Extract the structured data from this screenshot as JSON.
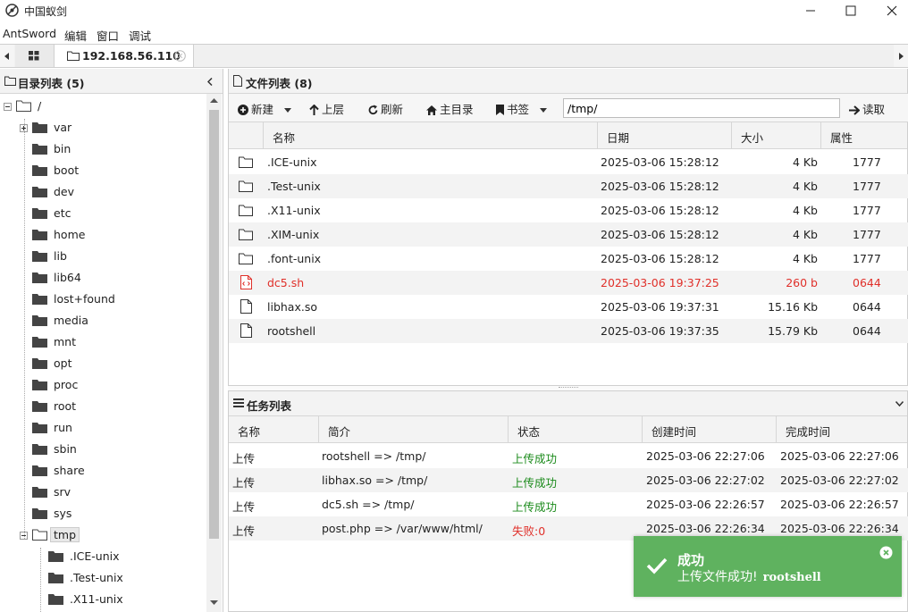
{
  "app": {
    "title": "中国蚁剑"
  },
  "menu": [
    "AntSword",
    "编辑",
    "窗口",
    "调试"
  ],
  "tabs": {
    "active_label": "192.168.56.110"
  },
  "dir_panel": {
    "title": "目录列表 (5)"
  },
  "tree": [
    {
      "label": "/",
      "depth": 0
    },
    {
      "label": "var",
      "depth": 1,
      "expandable": true
    },
    {
      "label": "bin",
      "depth": 1
    },
    {
      "label": "boot",
      "depth": 1
    },
    {
      "label": "dev",
      "depth": 1
    },
    {
      "label": "etc",
      "depth": 1
    },
    {
      "label": "home",
      "depth": 1
    },
    {
      "label": "lib",
      "depth": 1
    },
    {
      "label": "lib64",
      "depth": 1
    },
    {
      "label": "lost+found",
      "depth": 1
    },
    {
      "label": "media",
      "depth": 1
    },
    {
      "label": "mnt",
      "depth": 1
    },
    {
      "label": "opt",
      "depth": 1
    },
    {
      "label": "proc",
      "depth": 1
    },
    {
      "label": "root",
      "depth": 1
    },
    {
      "label": "run",
      "depth": 1
    },
    {
      "label": "sbin",
      "depth": 1
    },
    {
      "label": "share",
      "depth": 1
    },
    {
      "label": "srv",
      "depth": 1
    },
    {
      "label": "sys",
      "depth": 1
    },
    {
      "label": "tmp",
      "depth": 1,
      "open": true,
      "selected": true
    },
    {
      "label": ".ICE-unix",
      "depth": 2
    },
    {
      "label": ".Test-unix",
      "depth": 2
    },
    {
      "label": ".X11-unix",
      "depth": 2
    }
  ],
  "file_panel": {
    "title": "文件列表 (8)"
  },
  "toolbar": {
    "new_label": "新建",
    "up_label": "上层",
    "refresh_label": "刷新",
    "home_label": "主目录",
    "bookmark_label": "书签",
    "path_value": "/tmp/",
    "read_label": "读取"
  },
  "file_columns": [
    "名称",
    "日期",
    "大小",
    "属性"
  ],
  "files": [
    {
      "name": ".ICE-unix",
      "date": "2025-03-06 15:28:12",
      "size": "4 Kb",
      "perm": "1777",
      "type": "folder"
    },
    {
      "name": ".Test-unix",
      "date": "2025-03-06 15:28:12",
      "size": "4 Kb",
      "perm": "1777",
      "type": "folder"
    },
    {
      "name": ".X11-unix",
      "date": "2025-03-06 15:28:12",
      "size": "4 Kb",
      "perm": "1777",
      "type": "folder"
    },
    {
      "name": ".XIM-unix",
      "date": "2025-03-06 15:28:12",
      "size": "4 Kb",
      "perm": "1777",
      "type": "folder"
    },
    {
      "name": ".font-unix",
      "date": "2025-03-06 15:28:12",
      "size": "4 Kb",
      "perm": "1777",
      "type": "folder"
    },
    {
      "name": "dc5.sh",
      "date": "2025-03-06 19:37:25",
      "size": "260 b",
      "perm": "0644",
      "type": "script",
      "highlight": true
    },
    {
      "name": "libhax.so",
      "date": "2025-03-06 19:37:31",
      "size": "15.16 Kb",
      "perm": "0644",
      "type": "file"
    },
    {
      "name": "rootshell",
      "date": "2025-03-06 19:37:35",
      "size": "15.79 Kb",
      "perm": "0644",
      "type": "file"
    }
  ],
  "task_panel": {
    "title": "任务列表"
  },
  "task_columns": [
    "名称",
    "简介",
    "状态",
    "创建时间",
    "完成时间"
  ],
  "tasks": [
    {
      "name": "上传",
      "desc": "rootshell => /tmp/",
      "status": "上传成功",
      "ok": true,
      "created": "2025-03-06 22:27:06",
      "finished": "2025-03-06 22:27:06"
    },
    {
      "name": "上传",
      "desc": "libhax.so => /tmp/",
      "status": "上传成功",
      "ok": true,
      "created": "2025-03-06 22:27:02",
      "finished": "2025-03-06 22:27:02"
    },
    {
      "name": "上传",
      "desc": "dc5.sh => /tmp/",
      "status": "上传成功",
      "ok": true,
      "created": "2025-03-06 22:26:57",
      "finished": "2025-03-06 22:26:57"
    },
    {
      "name": "上传",
      "desc": "post.php => /var/www/html/",
      "status": "失败:0",
      "ok": false,
      "created": "2025-03-06 22:26:34",
      "finished": "2025-03-06 22:26:34"
    }
  ],
  "toast": {
    "title": "成功",
    "message": "上传文件成功!",
    "file": "rootshell"
  },
  "colors": {
    "highlight_red": "#e0302a",
    "success_green": "#1a8a1a",
    "toast_bg": "#5fb25f"
  }
}
